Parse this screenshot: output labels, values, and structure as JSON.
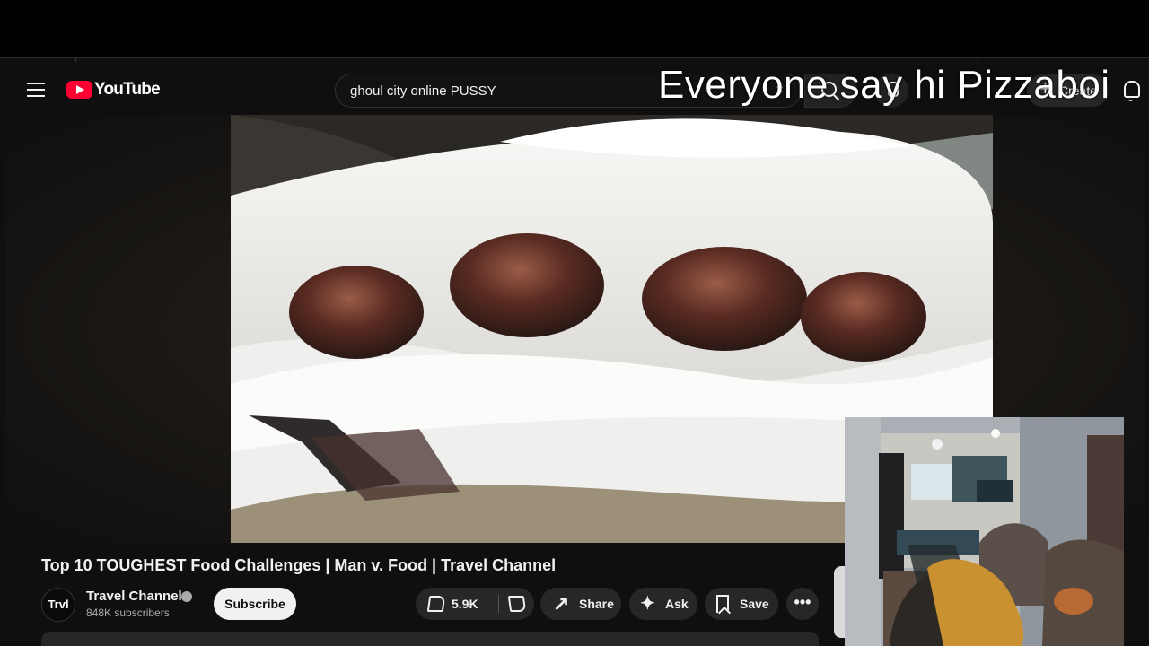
{
  "app": {
    "name": "YouTube",
    "logo_text": "YouTube"
  },
  "search": {
    "query": "ghoul city online PUSSY",
    "placeholder": ""
  },
  "header": {
    "create_label": "Create"
  },
  "overlay": {
    "caption": "Everyone say hi Pizzaboi"
  },
  "video": {
    "title": "Top 10 TOUGHEST Food Challenges | Man v. Food | Travel Channel"
  },
  "channel": {
    "avatar_text": "Trvl",
    "name": "Travel Channel",
    "subscribers": "848K subscribers",
    "subscribe_label": "Subscribe"
  },
  "actions": {
    "like_count": "5.9K",
    "share_label": "Share",
    "ask_label": "Ask",
    "save_label": "Save",
    "more_label": "•••"
  },
  "colors": {
    "background": "#0f0f0f",
    "brand_red": "#ff0033",
    "pill": "#272727",
    "text": "#f1f1f1",
    "muted": "#aaa"
  },
  "icons": {
    "menu": "hamburger-menu-icon",
    "search": "search-icon",
    "mic": "microphone-icon",
    "create": "plus-icon",
    "notifications": "bell-icon",
    "like": "thumbs-up-icon",
    "dislike": "thumbs-down-icon",
    "share": "share-arrow-icon",
    "ask": "sparkle-icon",
    "save": "bookmark-icon",
    "more": "ellipsis-icon"
  }
}
